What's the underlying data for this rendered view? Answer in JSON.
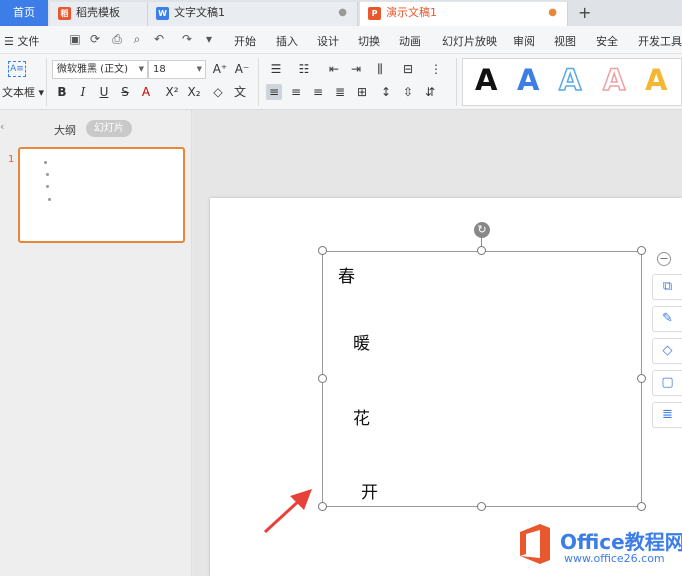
{
  "tabs": {
    "home": "首页",
    "items": [
      {
        "label": "稻壳模板",
        "icon": "docer-icon",
        "color": "#e8572d",
        "active": false,
        "close": ""
      },
      {
        "label": "文字文稿1",
        "icon": "writer-icon",
        "color": "#3d7de8",
        "active": false,
        "close": "●"
      },
      {
        "label": "演示文稿1",
        "icon": "presentation-icon",
        "color": "#e8572d",
        "active": true,
        "close": "●"
      }
    ],
    "new_tab": "+"
  },
  "menubar": {
    "file": "文件",
    "items": [
      "开始",
      "插入",
      "设计",
      "切换",
      "动画",
      "幻灯片放映",
      "审阅",
      "视图",
      "安全",
      "开发工具"
    ]
  },
  "ribbon": {
    "textbox_label": "文本框",
    "font_name": "微软雅黑 (正文)",
    "font_size": "18",
    "bold": "B",
    "italic": "I",
    "underline": "U",
    "strike": "S",
    "style_colors": [
      "#111111",
      "#3d7de8",
      "#5aa9e6",
      "#f0a0a0",
      "#f5b731"
    ]
  },
  "leftpanel": {
    "outline_tab": "大纲",
    "slides_tab": "幻灯片",
    "slide_number": "1"
  },
  "slide": {
    "characters": [
      "春",
      "暖",
      "花",
      "开"
    ]
  },
  "watermark": {
    "title": "Office教程网",
    "url": "www.office26.com"
  },
  "colors": {
    "accent": "#3d7de8",
    "active_tab": "#e8572d",
    "annotation_arrow": "#e8413a"
  }
}
